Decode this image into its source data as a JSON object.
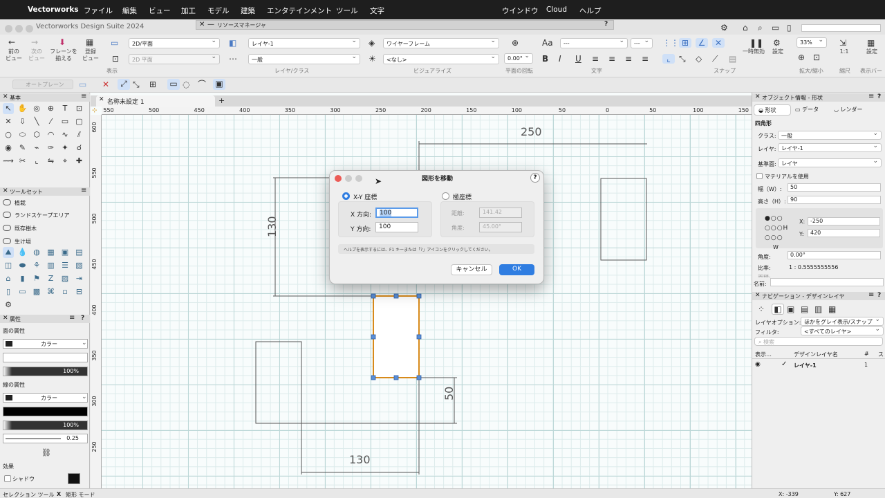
{
  "menubar": {
    "apple": "",
    "app": "Vectorworks",
    "items": [
      "ファイル",
      "編集",
      "ビュー",
      "加工",
      "モデル",
      "建築",
      "エンタテインメント",
      "ツール",
      "文字"
    ],
    "right": [
      "ウインドウ",
      "Cloud",
      "ヘルプ"
    ]
  },
  "window": {
    "title": "Vectorworks Design Suite 2024",
    "resource_manager": "リソースマネージャ",
    "help": "?"
  },
  "toolbar": {
    "nav": {
      "prev": "前の\nビュー",
      "next": "次の\nビュー",
      "flyover": "フレーンを\n揃える",
      "register": "登録\nビュー"
    },
    "view": {
      "plane": "2D/平面",
      "plane2": "2D 平面",
      "label": "表示"
    },
    "layer": {
      "layer": "レイヤ-1",
      "class": "一般",
      "label": "レイヤ/クラス"
    },
    "visualize": {
      "render": "ワイヤーフレーム",
      "light": "<なし>",
      "label": "ビジュアライズ"
    },
    "rotation": {
      "value": "0.00°",
      "label": "平面の回転"
    },
    "text": {
      "font": "---",
      "size": "---",
      "label": "文字",
      "bold": "B",
      "italic": "I",
      "underline": "U",
      "aa": "Aa"
    },
    "snap": {
      "label": "スナップ"
    },
    "pause": {
      "label": "一時無効"
    },
    "settings": {
      "label": "設定"
    },
    "zoom": {
      "value": "33%",
      "label": "拡大/縮小"
    },
    "scale": {
      "value": "1:1",
      "label": "縮尺"
    },
    "display": {
      "label": "設定",
      "label2": "表示バー"
    }
  },
  "modebar": {
    "auto_plane": "オートプレーン"
  },
  "document": {
    "tab": "名称未設定 1",
    "add": "+"
  },
  "left": {
    "basic_header": "基本",
    "toolset_header": "ツールセット",
    "toolsets": [
      "植栽",
      "ランドスケープエリア",
      "既存樹木",
      "生け垣"
    ],
    "attr_header": "属性",
    "fill_label": "面の属性",
    "fill_type": "カラー",
    "fill_opacity": "100%",
    "line_label": "線の属性",
    "line_type": "カラー",
    "line_opacity": "100%",
    "line_weight": "0.25",
    "effects": "効果",
    "shadow": "シャドウ"
  },
  "ruler": {
    "h": [
      "550",
      "500",
      "450",
      "400",
      "350",
      "300",
      "250",
      "200",
      "150",
      "100",
      "50",
      "0",
      "50",
      "100",
      "150"
    ],
    "v": [
      "600",
      "550",
      "500",
      "450",
      "400",
      "350",
      "300",
      "250"
    ]
  },
  "drawing": {
    "dim_top": "250",
    "dim_left": "130",
    "dim_bottom": "130",
    "dim_right": "50"
  },
  "dialog": {
    "title": "図形を移動",
    "help": "?",
    "xy_label": "X-Y 座標",
    "x_label": "X 方向:",
    "x_value": "100",
    "y_label": "Y 方向:",
    "y_value": "100",
    "polar_label": "極座標",
    "dist_label": "距離:",
    "dist_value": "141.42",
    "angle_label": "角度:",
    "angle_value": "45.00°",
    "hint": "ヘルプを表示するには、F1 キーまたは「?」アイコンをクリックしてください。",
    "cancel": "キャンセル",
    "ok": "OK"
  },
  "oip": {
    "header": "オブジェクト情報 - 形状",
    "tabs": [
      "形状",
      "データ",
      "レンダー"
    ],
    "type": "四角形",
    "class_label": "クラス:",
    "class_value": "一般",
    "layer_label": "レイヤ:",
    "layer_value": "レイヤ-1",
    "plane_label": "基準面:",
    "plane_value": "レイヤ",
    "material": "マテリアルを使用",
    "w_label": "幅（W）:",
    "w_value": "50",
    "h_label": "高さ（H）:",
    "h_value": "90",
    "x_label": "X:",
    "x_value": "-250",
    "y_label": "Y:",
    "y_value": "420",
    "angle_label": "角度:",
    "angle_value": "0.00°",
    "ratio_label": "比率:",
    "ratio_value": "1 : 0.5555555556",
    "area_label": "面積:",
    "area_value": "…",
    "name_label": "名前:"
  },
  "nav": {
    "header": "ナビゲーション - デザインレイヤ",
    "option_label": "レイヤオプション:",
    "option_value": "ほかをグレイ表示/スナップ",
    "filter_label": "フィルタ:",
    "filter_value": "<すべてのレイヤ>",
    "search": "検索",
    "col_display": "表示…",
    "col_name": "デザインレイヤ名",
    "col_num": "#",
    "col_s": "ス",
    "layer_name": "レイヤ-1",
    "layer_num": "1"
  },
  "status": {
    "tool": "セレクション ツール",
    "mode_x": "X",
    "mode": "矩形 モード",
    "x": "X: -339",
    "y": "Y: 627"
  }
}
